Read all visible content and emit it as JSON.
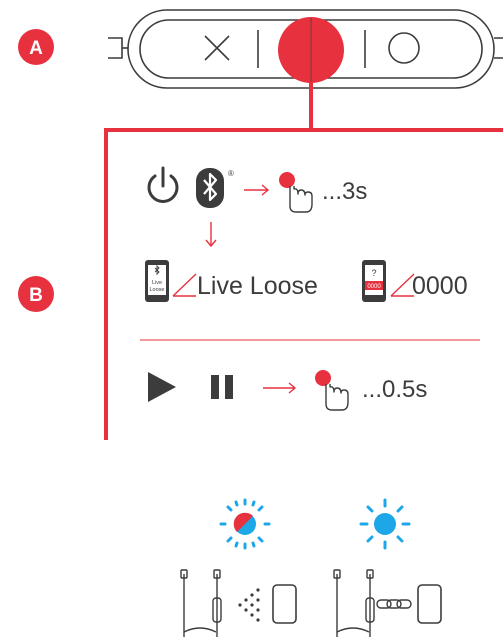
{
  "colors": {
    "accent": "#e8313f",
    "ink": "#3c3c3c",
    "led_blue": "#1ea7e8"
  },
  "markers": {
    "a": "A",
    "b": "B"
  },
  "remote": {
    "left_button_icon": "x-icon",
    "center_button_icon": "red-dot-icon",
    "right_button_icon": "circle-icon"
  },
  "pairing": {
    "time": "...3s",
    "bluetooth_symbol_mark": "®",
    "device_name": "Live Loose",
    "phone_screen_text_top": "Live",
    "phone_screen_text_bottom": "Loose",
    "pin_phone_symbol": "?",
    "pin_phone_code": "0000",
    "pin": "0000"
  },
  "playback": {
    "time": "...0.5s"
  },
  "icons": {
    "power": "power-icon",
    "bluetooth": "bluetooth-icon",
    "press": "finger-press-icon",
    "play": "play-icon",
    "pause": "pause-icon",
    "phone": "phone-icon",
    "led_pairing": "led-blinking-red-blue-icon",
    "led_connected": "led-solid-blue-icon",
    "earphones": "earphones-icon"
  }
}
